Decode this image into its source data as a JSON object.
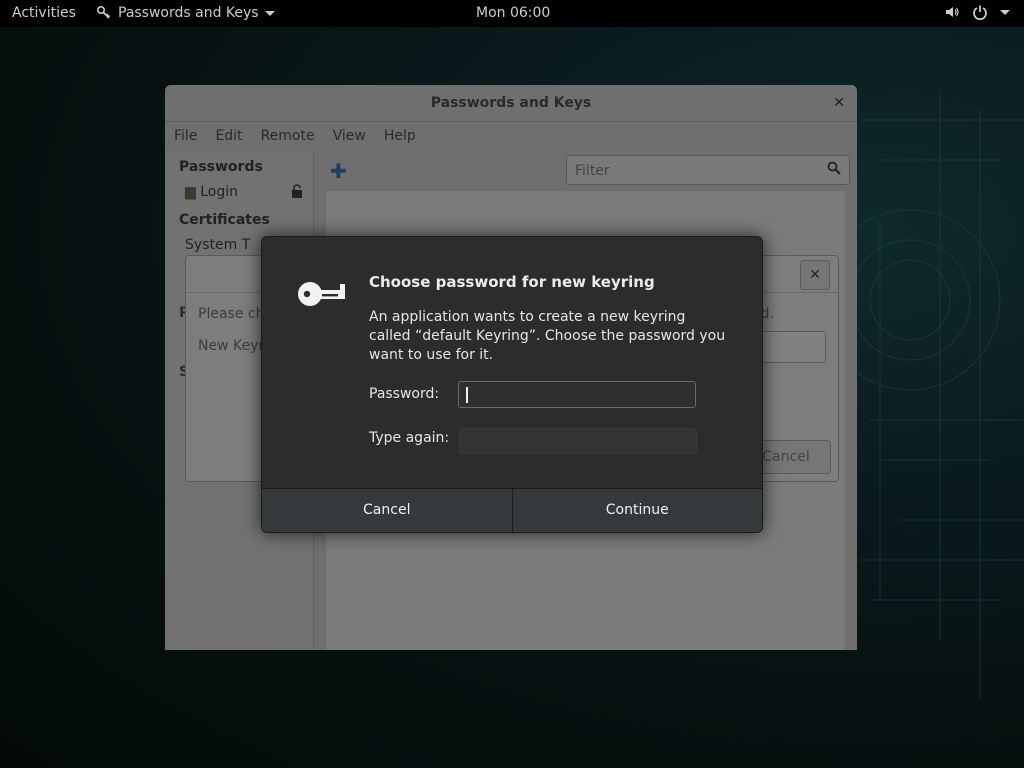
{
  "topbar": {
    "activities": "Activities",
    "app_name": "Passwords and Keys",
    "clock": "Mon 06:00"
  },
  "main_window": {
    "title": "Passwords and Keys",
    "menu": [
      "File",
      "Edit",
      "Remote",
      "View",
      "Help"
    ],
    "sidebar": {
      "passwords_header": "Passwords",
      "login_item": "Login",
      "certificates_header": "Certificates",
      "system_item": "System T",
      "hidden_p": "P",
      "hidden_s": "S"
    },
    "filter_placeholder": "Filter"
  },
  "mid_dialog": {
    "text1": "Please ch",
    "text2": "New Keyr",
    "text3": "d.",
    "cancel": "Cancel"
  },
  "modal": {
    "title": "Choose password for new keyring",
    "description": "An application wants to create a new keyring called “default Keyring”. Choose the password you want to use for it.",
    "password_label": "Password:",
    "type_again_label": "Type again:",
    "cancel_button": "Cancel",
    "continue_button": "Continue"
  },
  "icons": {
    "app_icon": "keys-icon",
    "sound": "speaker-icon",
    "power": "power-icon",
    "lock": "lock-open-icon",
    "search": "search-icon",
    "add": "plus-icon",
    "key": "key-icon"
  }
}
